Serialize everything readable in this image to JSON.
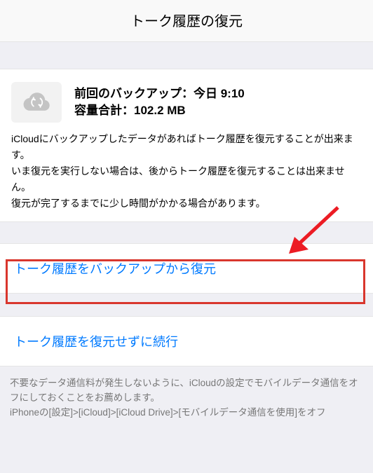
{
  "header": {
    "title": "トーク履歴の復元"
  },
  "backup": {
    "last_backup_label": "前回のバックアップ：",
    "last_backup_value": "今日 9:10",
    "total_size_label": "容量合計：",
    "total_size_value": "102.2 MB"
  },
  "description": {
    "line1": "iCloudにバックアップしたデータがあればトーク履歴を復元することが出来ます。",
    "line2": "いま復元を実行しない場合は、後からトーク履歴を復元することは出来ません。",
    "line3": "復元が完了するまでに少し時間がかかる場合があります。"
  },
  "actions": {
    "restore_from_backup": "トーク履歴をバックアップから復元",
    "continue_without_restore": "トーク履歴を復元せずに続行"
  },
  "footer": {
    "line1": "不要なデータ通信料が発生しないように、iCloudの設定でモバイルデータ通信をオフにしておくことをお薦めします。",
    "line2": "iPhoneの[設定]>[iCloud]>[iCloud Drive]>[モバイルデータ通信を使用]をオフ"
  },
  "annotation": {
    "highlight_color": "#d9362d",
    "arrow_color": "#ec1c24"
  }
}
